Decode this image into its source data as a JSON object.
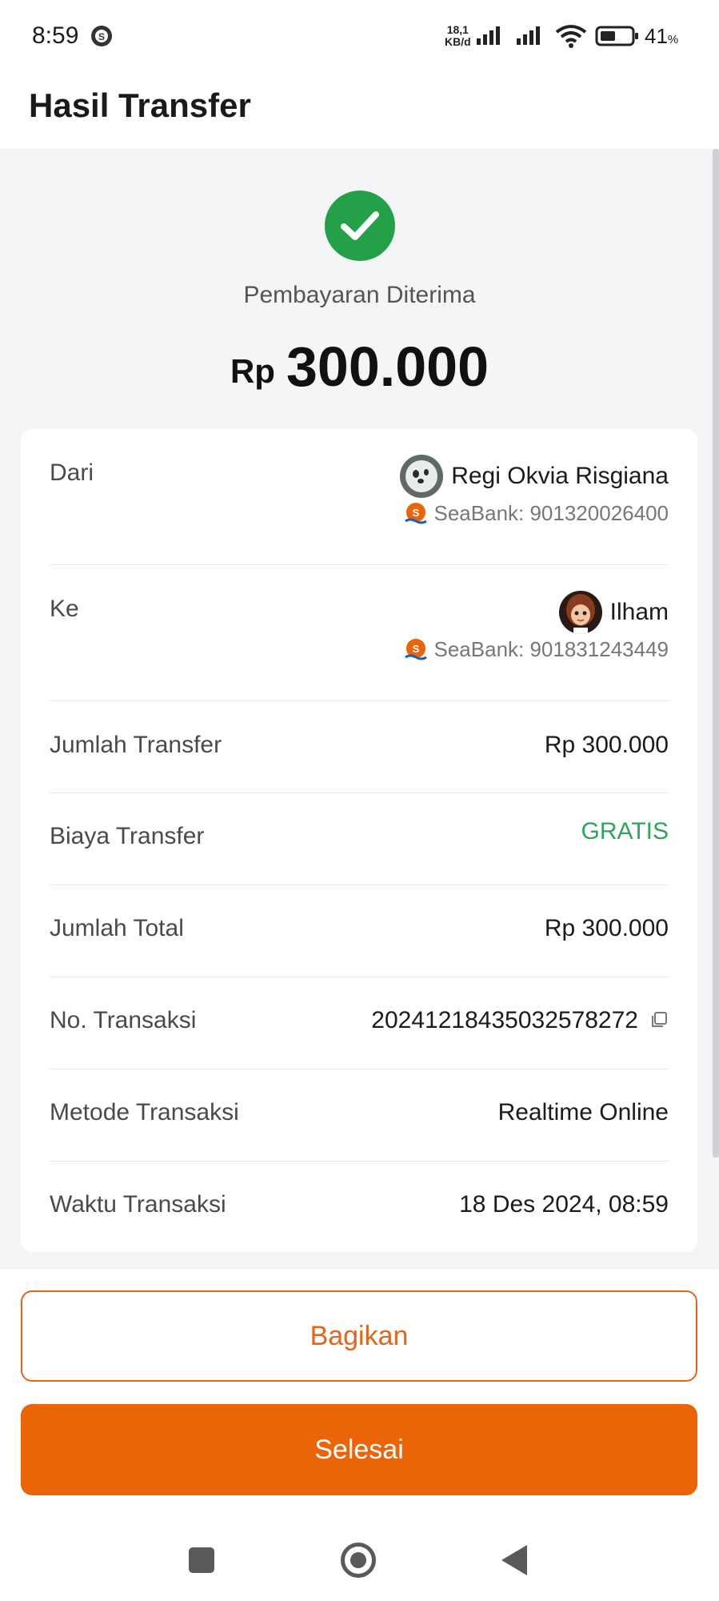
{
  "status_bar": {
    "time": "8:59",
    "speed_value": "18,1",
    "speed_unit": "KB/d",
    "battery_percent": "41",
    "battery_unit": "%",
    "icons": [
      "app-notification-icon",
      "signal-icon",
      "signal-icon",
      "wifi-icon",
      "battery-icon"
    ]
  },
  "header": {
    "title": "Hasil Transfer"
  },
  "result": {
    "status_text": "Pembayaran Diterima",
    "currency": "Rp",
    "amount": "300.000",
    "status_color": "#24a148"
  },
  "details": {
    "from": {
      "label": "Dari",
      "name": "Regi Okvia Risgiana",
      "bank": "SeaBank: 901320026400"
    },
    "to": {
      "label": "Ke",
      "name": "Ilham",
      "bank": "SeaBank: 901831243449"
    },
    "rows": [
      {
        "label": "Jumlah Transfer",
        "value": "Rp 300.000"
      },
      {
        "label": "Biaya Transfer",
        "value": "GRATIS"
      },
      {
        "label": "Jumlah Total",
        "value": "Rp 300.000"
      },
      {
        "label": "No. Transaksi",
        "value": "20241218435032578272"
      },
      {
        "label": "Metode Transaksi",
        "value": "Realtime Online"
      },
      {
        "label": "Waktu Transaksi",
        "value": "18 Des 2024, 08:59"
      }
    ]
  },
  "actions": {
    "share_label": "Bagikan",
    "done_label": "Selesai",
    "accent_color": "#ec6408"
  },
  "nav_bar": {
    "icons": [
      "recent-apps-icon",
      "home-icon",
      "back-icon"
    ]
  }
}
